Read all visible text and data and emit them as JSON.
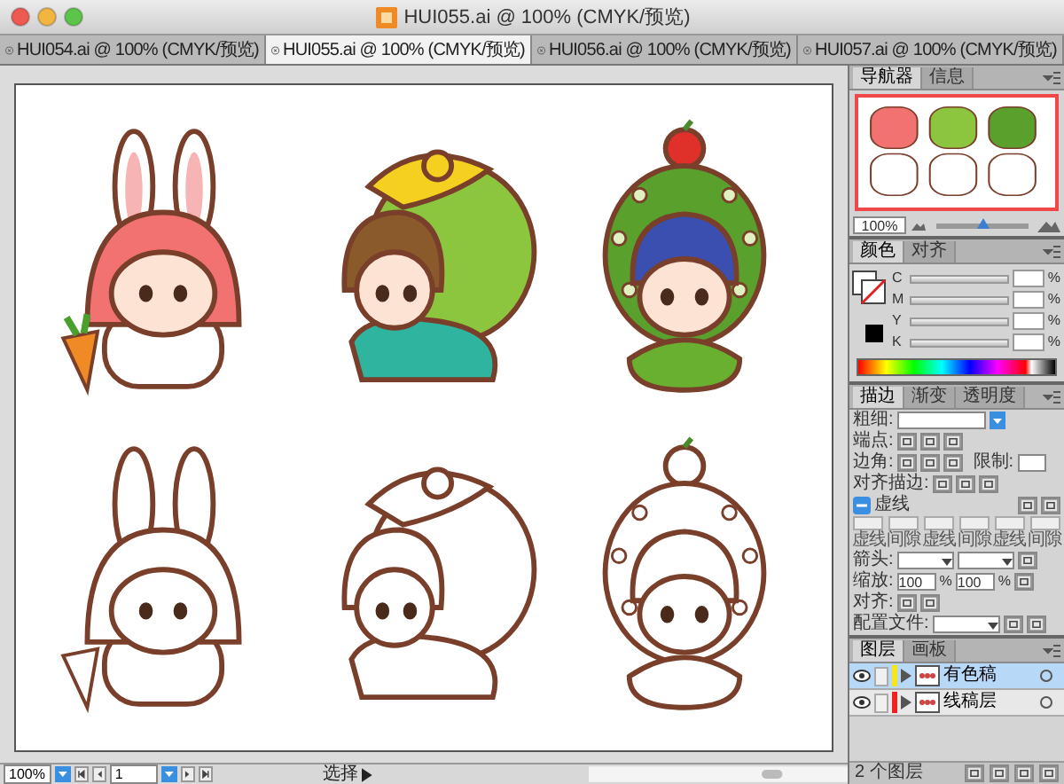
{
  "window": {
    "title": "HUI055.ai @ 100% (CMYK/预览)"
  },
  "doc_tabs": [
    {
      "label": "HUI054.ai @ 100% (CMYK/预览)",
      "selected": false
    },
    {
      "label": "HUI055.ai @ 100% (CMYK/预览)",
      "selected": true
    },
    {
      "label": "HUI056.ai @ 100% (CMYK/预览)",
      "selected": false
    },
    {
      "label": "HUI057.ai @ 100% (CMYK/预览)",
      "selected": false
    }
  ],
  "colored_artworks": [
    {
      "kind": "bunny"
    },
    {
      "kind": "dragon"
    },
    {
      "kind": "snake"
    }
  ],
  "line_artworks": [
    {
      "kind": "bunny"
    },
    {
      "kind": "dragon"
    },
    {
      "kind": "snake"
    }
  ],
  "status_bar": {
    "zoom": "100%",
    "page": "1",
    "tool": "选择"
  },
  "navigator": {
    "tabs": [
      {
        "label": "导航器",
        "selected": true
      },
      {
        "label": "信息",
        "selected": false
      }
    ],
    "zoom": "100%",
    "level": 0.5
  },
  "color": {
    "tabs": [
      {
        "label": "颜色",
        "selected": true
      },
      {
        "label": "对齐",
        "selected": false
      }
    ],
    "channels": [
      {
        "name": "C",
        "unit": "%",
        "level": 0
      },
      {
        "name": "M",
        "unit": "%",
        "level": 0
      },
      {
        "name": "Y",
        "unit": "%",
        "level": 0
      },
      {
        "name": "K",
        "unit": "%",
        "level": 0
      }
    ]
  },
  "stroke": {
    "tabs": [
      {
        "label": "描边",
        "selected": true
      },
      {
        "label": "渐变",
        "selected": false
      },
      {
        "label": "透明度",
        "selected": false
      }
    ],
    "weight_label": "粗细:",
    "cap_label": "端点:",
    "corner_label": "边角:",
    "limit_label": "限制:",
    "align_label": "对齐描边:",
    "dashed_label": "虚线",
    "dash_fields": [
      "虚线",
      "间隙",
      "虚线",
      "间隙",
      "虚线",
      "间隙"
    ],
    "arrows_label": "箭头:",
    "scale_label": "缩放:",
    "scale_values": [
      {
        "value": "100",
        "unit": "%"
      },
      {
        "value": "100",
        "unit": "%"
      }
    ],
    "arrow_align_label": "对齐:",
    "profile_label": "配置文件:"
  },
  "layers": {
    "tabs": [
      {
        "label": "图层",
        "selected": true
      },
      {
        "label": "画板",
        "selected": false
      }
    ],
    "items": [
      {
        "name": "有色稿",
        "color": "#f5e61a",
        "selected": true
      },
      {
        "name": "线稿层",
        "color": "#ee2222",
        "selected": false
      }
    ],
    "count": "2 个图层"
  }
}
